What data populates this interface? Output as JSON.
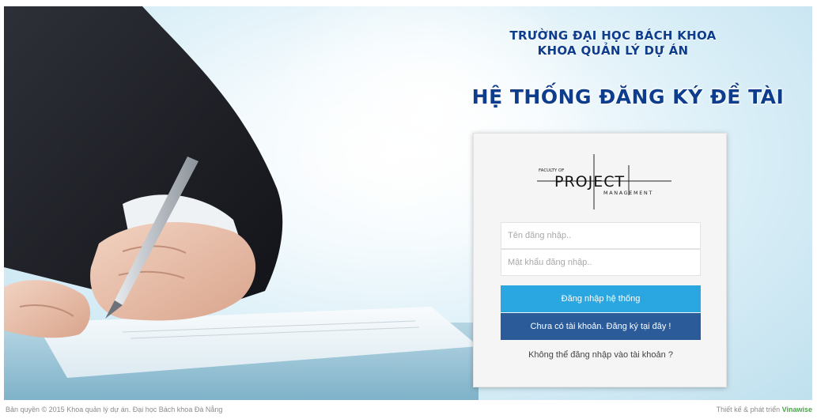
{
  "header": {
    "university": "TRƯỜNG ĐẠI HỌC BÁCH KHOA",
    "faculty": "KHOA QUẢN LÝ DỰ ÁN",
    "system_title": "HỆ THỐNG ĐĂNG KÝ ĐỀ TÀI"
  },
  "logo": {
    "small_text": "FACULTY OF",
    "main_text": "PROJECT",
    "sub_text": "MANAGEMENT"
  },
  "login": {
    "username_placeholder": "Tên đăng nhập..",
    "password_placeholder": "Mật khẩu đăng nhập..",
    "login_button": "Đăng nhập hệ thống",
    "register_button": "Chưa có tài khoản. Đăng ký tại đây !",
    "forgot_link": "Không thể đăng nhập vào tài khoản ?"
  },
  "footer": {
    "copyright": "Bản quyền © 2015 Khoa quản lý dự án. Đại học Bách khoa Đà Nẵng",
    "credit_prefix": "Thiết kế & phát triển",
    "credit_brand": "Vinawise"
  },
  "colors": {
    "title_blue": "#0d3d8c",
    "login_button": "#2aa6e1",
    "register_button": "#2b5b99",
    "brand_green": "#4aa54a"
  }
}
